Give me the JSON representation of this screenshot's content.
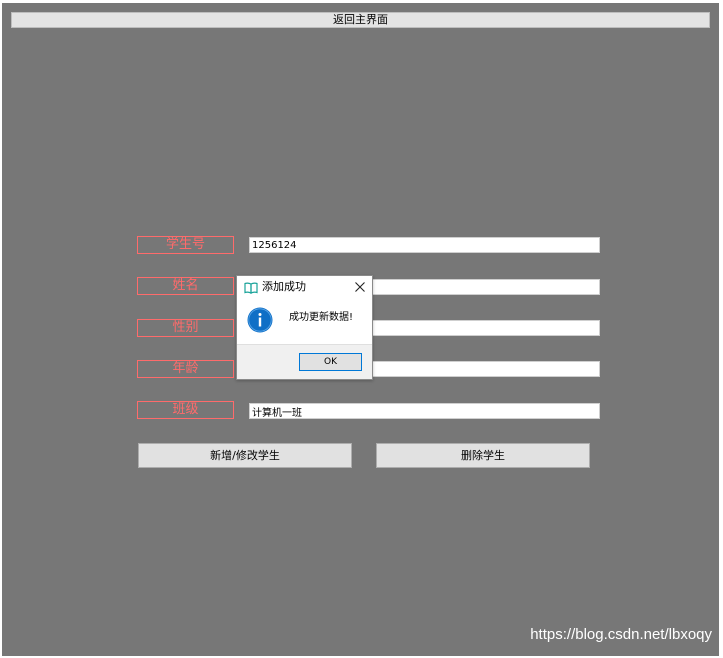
{
  "header": {
    "back_label": "返回主界面"
  },
  "form": {
    "student_id": {
      "label": "学生号",
      "value": "1256124"
    },
    "name": {
      "label": "姓名",
      "value": ""
    },
    "gender": {
      "label": "性别",
      "value": ""
    },
    "age": {
      "label": "年龄",
      "value": ""
    },
    "class": {
      "label": "班级",
      "value": "计算机一班"
    }
  },
  "actions": {
    "add_modify_label": "新增/修改学生",
    "delete_label": "删除学生"
  },
  "dialog": {
    "title": "添加成功",
    "message": "成功更新数据!",
    "ok_label": "OK",
    "icon": "info-icon",
    "accent": "#0078d7"
  },
  "watermark": "https://blog.csdn.net/lbxoqy",
  "colors": {
    "background": "#777777",
    "label_accent": "#ff6b6b"
  }
}
